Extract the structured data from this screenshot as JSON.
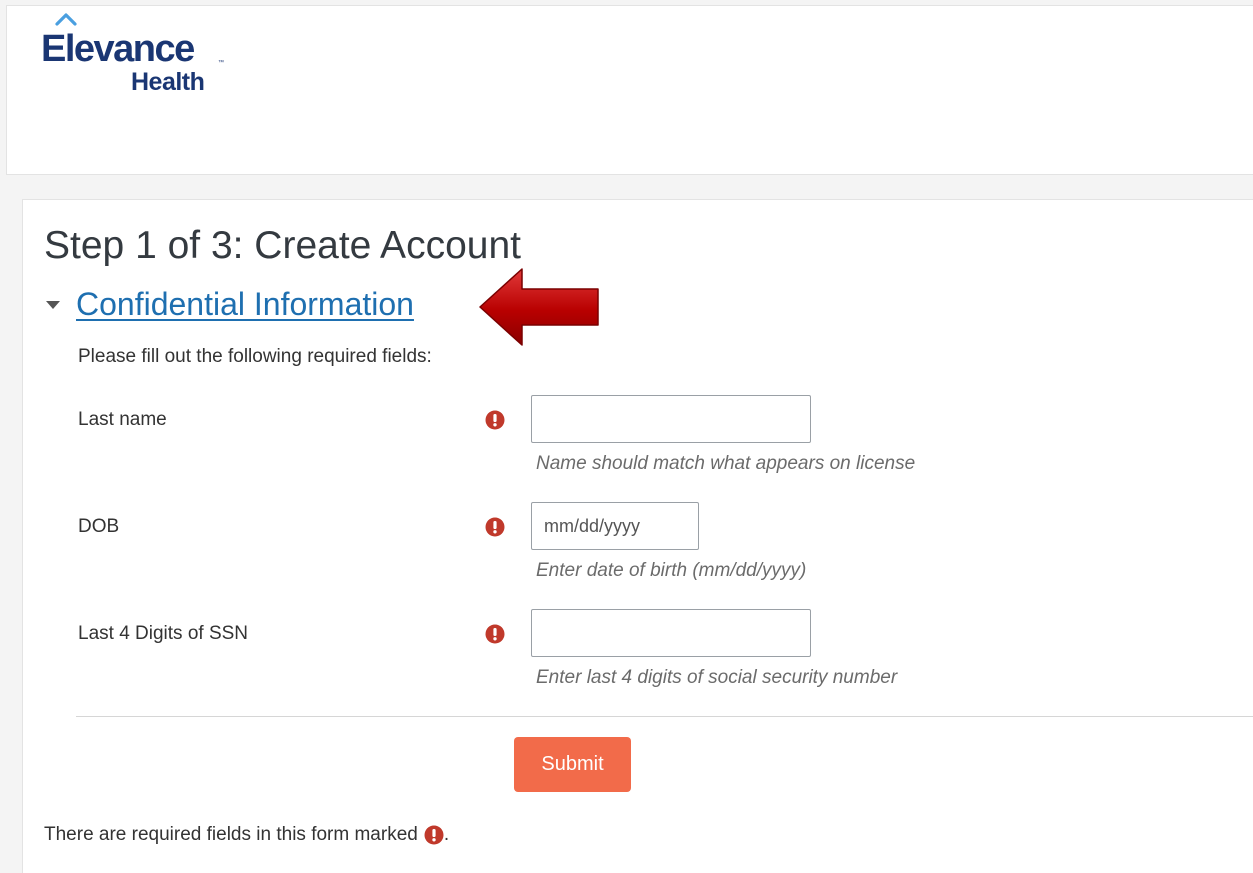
{
  "brand": {
    "name_line1": "Elevance",
    "name_line2": "Health",
    "trademark": "™",
    "color": "#1a3673",
    "accent": "#4a9fe0"
  },
  "page": {
    "title": "Step 1 of 3: Create Account"
  },
  "section": {
    "title": "Confidential Information",
    "expanded": true,
    "link_color": "#1e6fb0",
    "instructions": "Please fill out the following required fields:"
  },
  "form": {
    "fields": [
      {
        "label": "Last name",
        "required": true,
        "value": "",
        "placeholder": "",
        "help": "Name should match what appears on license"
      },
      {
        "label": "DOB",
        "required": true,
        "value": "",
        "placeholder": "mm/dd/yyyy",
        "help": "Enter date of birth (mm/dd/yyyy)"
      },
      {
        "label": "Last 4 Digits of SSN",
        "required": true,
        "value": "",
        "placeholder": "",
        "help": "Enter last 4 digits of social security number"
      }
    ],
    "submit_label": "Submit",
    "submit_color": "#f26b4a",
    "required_note": "There are required fields in this form marked",
    "required_note_end": ".",
    "required_icon_color": "#c0392b"
  },
  "annotation": {
    "arrow_icon": "red-arrow-pointing-left",
    "arrow_color": "#c00000"
  }
}
